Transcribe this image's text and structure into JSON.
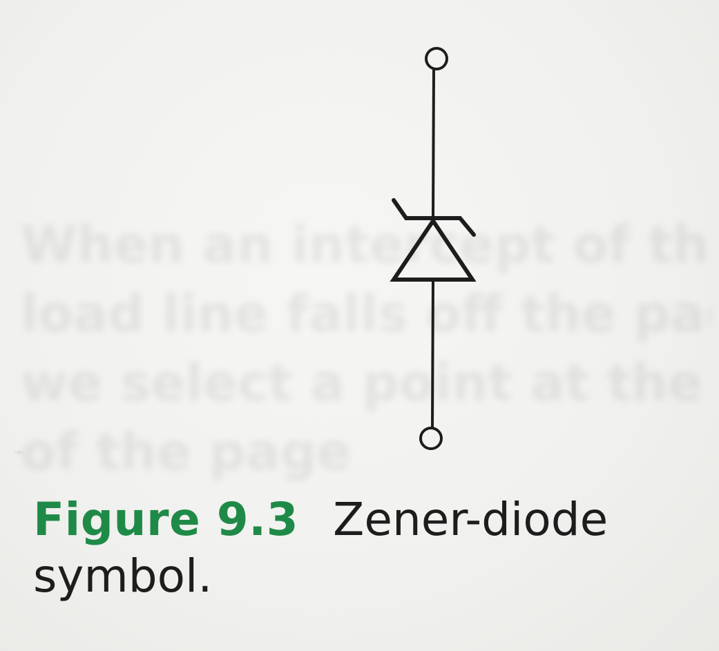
{
  "figure": {
    "label": "Figure 9.3",
    "title": "Zener-diode",
    "title_cont": "symbol."
  },
  "bleed_through": {
    "lines": [
      "When an intercept of the",
      "load line falls off the page",
      "we select a point at the e",
      "of the page"
    ]
  },
  "symbol": {
    "name": "zener-diode",
    "terminals": 2
  },
  "colors": {
    "background": "#f3f3f1",
    "ink": "#1d1d1d",
    "figure_label": "#1f8a47"
  }
}
